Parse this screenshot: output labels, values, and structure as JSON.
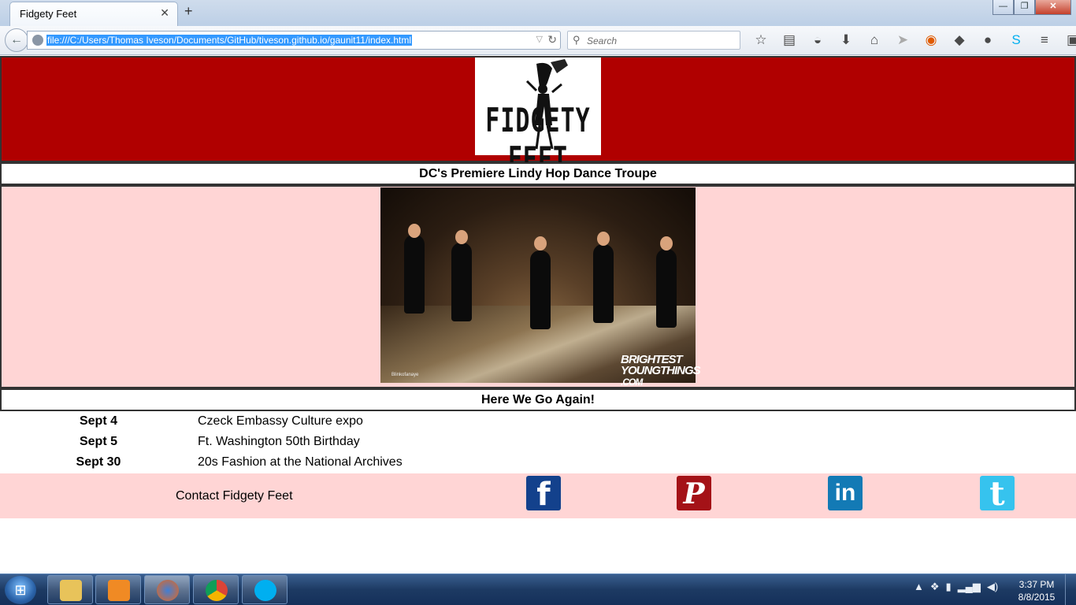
{
  "browser": {
    "tab_title": "Fidgety Feet",
    "tab_close": "✕",
    "new_tab": "+",
    "url": "file:///C:/Users/Thomas Iveson/Documents/GitHub/tiveson.github.io/gaunit11/index.html",
    "search_placeholder": "Search"
  },
  "window_controls": {
    "minimize": "—",
    "restore": "❐",
    "close": "✕"
  },
  "toolbar_icons": [
    "bookmark-star-icon",
    "reading-list-icon",
    "pocket-icon",
    "download-icon",
    "home-icon",
    "send-icon",
    "addon-icon",
    "share-icon",
    "chat-icon",
    "skype-icon",
    "menu-icon",
    "extension-icon"
  ],
  "site": {
    "logo_text": "FIDGETY FEET",
    "tagline": "DC's Premiere Lindy Hop Dance Troupe",
    "photo_credit": "Blinkofanaye",
    "photo_watermark_top": "BRIGHTEST",
    "photo_watermark_mid": "YOUNGTHINGS",
    "photo_watermark_bottom": ".COM",
    "subhead": "Here We Go Again!",
    "events": [
      {
        "date": "Sept 4",
        "name": "Czeck Embassy Culture expo"
      },
      {
        "date": "Sept 5",
        "name": "Ft. Washington 50th Birthday"
      },
      {
        "date": "Sept 30",
        "name": "20s Fashion at the National Archives"
      }
    ],
    "contact": "Contact Fidgety Feet",
    "social": {
      "facebook": "f",
      "pinterest": "P",
      "linkedin": "in",
      "twitter": "t"
    }
  },
  "taskbar": {
    "apps": [
      "file-explorer-icon",
      "media-player-icon",
      "firefox-icon",
      "chrome-icon",
      "skype-icon"
    ],
    "clock_time": "3:37 PM",
    "clock_date": "8/8/2015"
  },
  "colors": {
    "header_red": "#b00000",
    "pink_bg": "#ffd5d5",
    "facebook": "#13418c",
    "pinterest": "#a41217",
    "linkedin": "#137ab5",
    "twitter": "#36c3ee"
  }
}
